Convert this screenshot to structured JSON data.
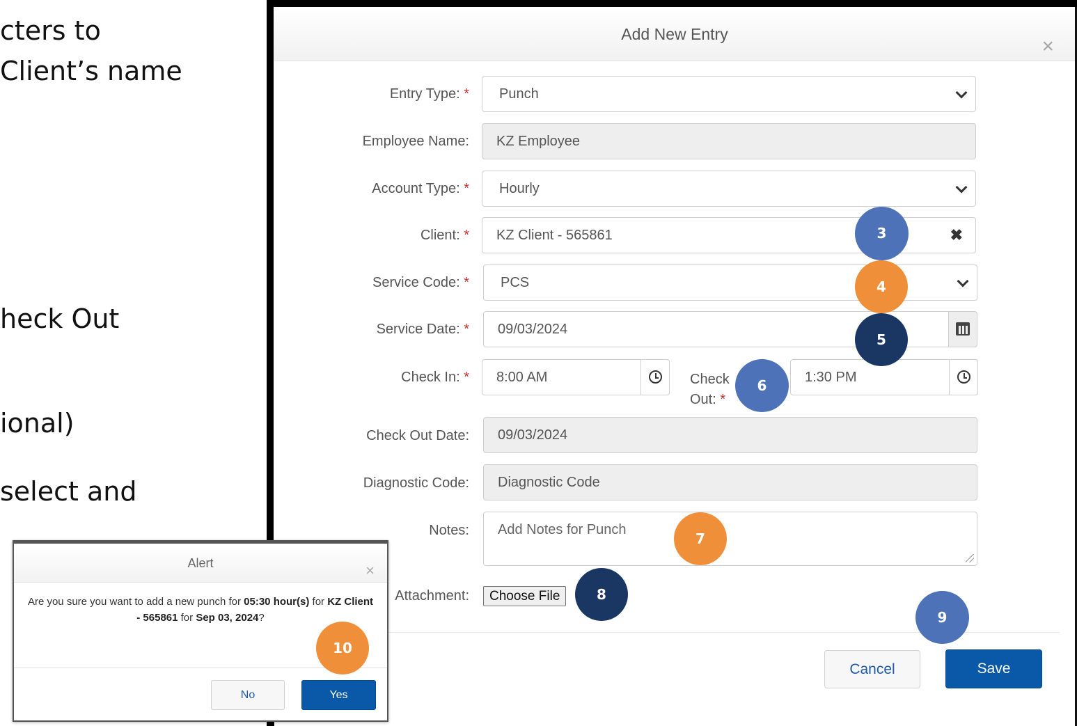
{
  "instructions": {
    "line1": "cters to",
    "line2": "Client’s name",
    "line3": "heck Out",
    "line4": "ional)",
    "line5": "select and"
  },
  "modal": {
    "title": "Add New Entry",
    "close_icon": "close-icon",
    "fields": {
      "entry_type": {
        "label": "Entry Type:",
        "value": "Punch"
      },
      "employee_name": {
        "label": "Employee Name:",
        "value": "KZ Employee"
      },
      "account_type": {
        "label": "Account Type:",
        "value": "Hourly"
      },
      "client": {
        "label": "Client:",
        "value": "KZ Client - 565861",
        "clear": "✖"
      },
      "service_code": {
        "label": "Service Code:",
        "value": "PCS"
      },
      "service_date": {
        "label": "Service Date:",
        "value": "09/03/2024"
      },
      "check_in": {
        "label": "Check In:",
        "value": "8:00 AM"
      },
      "check_out": {
        "label_line1": "Check",
        "label_line2": "Out:",
        "value": "1:30 PM"
      },
      "check_out_date": {
        "label": "Check Out Date:",
        "value": "09/03/2024"
      },
      "diagnostic_code": {
        "label": "Diagnostic Code:",
        "placeholder": "Diagnostic Code"
      },
      "notes": {
        "label": "Notes:",
        "placeholder": "Add Notes for Punch"
      },
      "attachment": {
        "label": "Attachment:",
        "button": "Choose File"
      }
    },
    "required_mark": "*",
    "buttons": {
      "cancel": "Cancel",
      "save": "Save"
    }
  },
  "alert": {
    "title": "Alert",
    "message_prefix": "Are you sure you want to add a new punch for ",
    "hours": "05:30 hour(s)",
    "message_mid": " for ",
    "client": "KZ Client - 565861",
    "message_mid2": " for ",
    "date": "Sep 03, 2024",
    "message_suffix": "?",
    "buttons": {
      "no": "No",
      "yes": "Yes"
    }
  },
  "step_badges": [
    {
      "label": "3",
      "color": "#4e72b8"
    },
    {
      "label": "4",
      "color": "#ef8f3a"
    },
    {
      "label": "5",
      "color": "#1a3662"
    },
    {
      "label": "6",
      "color": "#4e72b8"
    },
    {
      "label": "7",
      "color": "#ef8f3a"
    },
    {
      "label": "8",
      "color": "#1a3662"
    },
    {
      "label": "9",
      "color": "#4e72b8"
    },
    {
      "label": "10",
      "color": "#ef8f3a"
    }
  ],
  "colors": {
    "primary_button": "#0a58a8",
    "required": "#c9302c",
    "disabled_field": "#eeeeee"
  }
}
